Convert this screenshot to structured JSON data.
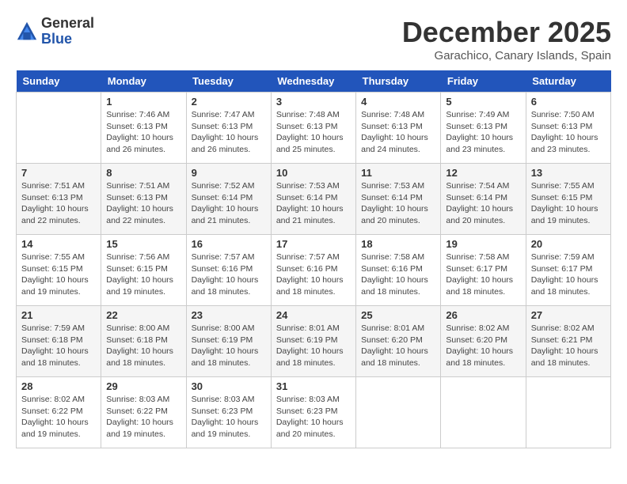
{
  "logo": {
    "general": "General",
    "blue": "Blue"
  },
  "title": "December 2025",
  "location": "Garachico, Canary Islands, Spain",
  "days_of_week": [
    "Sunday",
    "Monday",
    "Tuesday",
    "Wednesday",
    "Thursday",
    "Friday",
    "Saturday"
  ],
  "weeks": [
    [
      {
        "day": "",
        "info": ""
      },
      {
        "day": "1",
        "info": "Sunrise: 7:46 AM\nSunset: 6:13 PM\nDaylight: 10 hours\nand 26 minutes."
      },
      {
        "day": "2",
        "info": "Sunrise: 7:47 AM\nSunset: 6:13 PM\nDaylight: 10 hours\nand 26 minutes."
      },
      {
        "day": "3",
        "info": "Sunrise: 7:48 AM\nSunset: 6:13 PM\nDaylight: 10 hours\nand 25 minutes."
      },
      {
        "day": "4",
        "info": "Sunrise: 7:48 AM\nSunset: 6:13 PM\nDaylight: 10 hours\nand 24 minutes."
      },
      {
        "day": "5",
        "info": "Sunrise: 7:49 AM\nSunset: 6:13 PM\nDaylight: 10 hours\nand 23 minutes."
      },
      {
        "day": "6",
        "info": "Sunrise: 7:50 AM\nSunset: 6:13 PM\nDaylight: 10 hours\nand 23 minutes."
      }
    ],
    [
      {
        "day": "7",
        "info": "Sunrise: 7:51 AM\nSunset: 6:13 PM\nDaylight: 10 hours\nand 22 minutes."
      },
      {
        "day": "8",
        "info": "Sunrise: 7:51 AM\nSunset: 6:13 PM\nDaylight: 10 hours\nand 22 minutes."
      },
      {
        "day": "9",
        "info": "Sunrise: 7:52 AM\nSunset: 6:14 PM\nDaylight: 10 hours\nand 21 minutes."
      },
      {
        "day": "10",
        "info": "Sunrise: 7:53 AM\nSunset: 6:14 PM\nDaylight: 10 hours\nand 21 minutes."
      },
      {
        "day": "11",
        "info": "Sunrise: 7:53 AM\nSunset: 6:14 PM\nDaylight: 10 hours\nand 20 minutes."
      },
      {
        "day": "12",
        "info": "Sunrise: 7:54 AM\nSunset: 6:14 PM\nDaylight: 10 hours\nand 20 minutes."
      },
      {
        "day": "13",
        "info": "Sunrise: 7:55 AM\nSunset: 6:15 PM\nDaylight: 10 hours\nand 19 minutes."
      }
    ],
    [
      {
        "day": "14",
        "info": "Sunrise: 7:55 AM\nSunset: 6:15 PM\nDaylight: 10 hours\nand 19 minutes."
      },
      {
        "day": "15",
        "info": "Sunrise: 7:56 AM\nSunset: 6:15 PM\nDaylight: 10 hours\nand 19 minutes."
      },
      {
        "day": "16",
        "info": "Sunrise: 7:57 AM\nSunset: 6:16 PM\nDaylight: 10 hours\nand 18 minutes."
      },
      {
        "day": "17",
        "info": "Sunrise: 7:57 AM\nSunset: 6:16 PM\nDaylight: 10 hours\nand 18 minutes."
      },
      {
        "day": "18",
        "info": "Sunrise: 7:58 AM\nSunset: 6:16 PM\nDaylight: 10 hours\nand 18 minutes."
      },
      {
        "day": "19",
        "info": "Sunrise: 7:58 AM\nSunset: 6:17 PM\nDaylight: 10 hours\nand 18 minutes."
      },
      {
        "day": "20",
        "info": "Sunrise: 7:59 AM\nSunset: 6:17 PM\nDaylight: 10 hours\nand 18 minutes."
      }
    ],
    [
      {
        "day": "21",
        "info": "Sunrise: 7:59 AM\nSunset: 6:18 PM\nDaylight: 10 hours\nand 18 minutes."
      },
      {
        "day": "22",
        "info": "Sunrise: 8:00 AM\nSunset: 6:18 PM\nDaylight: 10 hours\nand 18 minutes."
      },
      {
        "day": "23",
        "info": "Sunrise: 8:00 AM\nSunset: 6:19 PM\nDaylight: 10 hours\nand 18 minutes."
      },
      {
        "day": "24",
        "info": "Sunrise: 8:01 AM\nSunset: 6:19 PM\nDaylight: 10 hours\nand 18 minutes."
      },
      {
        "day": "25",
        "info": "Sunrise: 8:01 AM\nSunset: 6:20 PM\nDaylight: 10 hours\nand 18 minutes."
      },
      {
        "day": "26",
        "info": "Sunrise: 8:02 AM\nSunset: 6:20 PM\nDaylight: 10 hours\nand 18 minutes."
      },
      {
        "day": "27",
        "info": "Sunrise: 8:02 AM\nSunset: 6:21 PM\nDaylight: 10 hours\nand 18 minutes."
      }
    ],
    [
      {
        "day": "28",
        "info": "Sunrise: 8:02 AM\nSunset: 6:22 PM\nDaylight: 10 hours\nand 19 minutes."
      },
      {
        "day": "29",
        "info": "Sunrise: 8:03 AM\nSunset: 6:22 PM\nDaylight: 10 hours\nand 19 minutes."
      },
      {
        "day": "30",
        "info": "Sunrise: 8:03 AM\nSunset: 6:23 PM\nDaylight: 10 hours\nand 19 minutes."
      },
      {
        "day": "31",
        "info": "Sunrise: 8:03 AM\nSunset: 6:23 PM\nDaylight: 10 hours\nand 20 minutes."
      },
      {
        "day": "",
        "info": ""
      },
      {
        "day": "",
        "info": ""
      },
      {
        "day": "",
        "info": ""
      }
    ]
  ]
}
